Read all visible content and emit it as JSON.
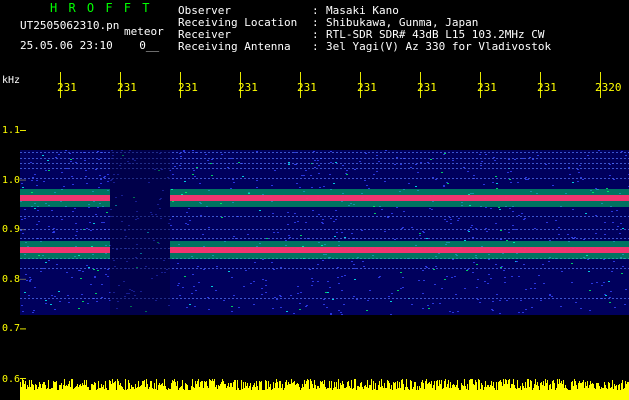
{
  "header": {
    "logo": "H R O F F T",
    "filename": "UT2505062310.pn",
    "filename_suffix": "meteor",
    "datetime": "25.05.06 23:10    0__",
    "info_labels": "Observer\nReceiving Location\nReceiver\nReceiving Antenna",
    "info_colons": ":\n:\n:\n:",
    "info_values": "Masaki Kano\nShibukawa, Gunma, Japan\nRTL-SDR SDR# 43dB L15 103.2MHz CW\n3el Yagi(V) Az 330 for Vladivostok"
  },
  "axis": {
    "y_unit": "kHz",
    "y_ticks": [
      "1.1",
      "1.0",
      "0.9",
      "0.8",
      "0.7",
      "0.6"
    ],
    "x_ticks": [
      "231",
      "231",
      "231",
      "231",
      "231",
      "231",
      "231",
      "231",
      "231",
      "2320"
    ]
  },
  "colors": {
    "background": "#000000",
    "label_text": "#ffffff",
    "logo": "#00ff00",
    "ticks": "#ffff00",
    "signal_strong": "#ff3070",
    "signal_mid": "#00ff66",
    "noise": "#0000aa",
    "amplitude_trace": "#ffff00"
  }
}
